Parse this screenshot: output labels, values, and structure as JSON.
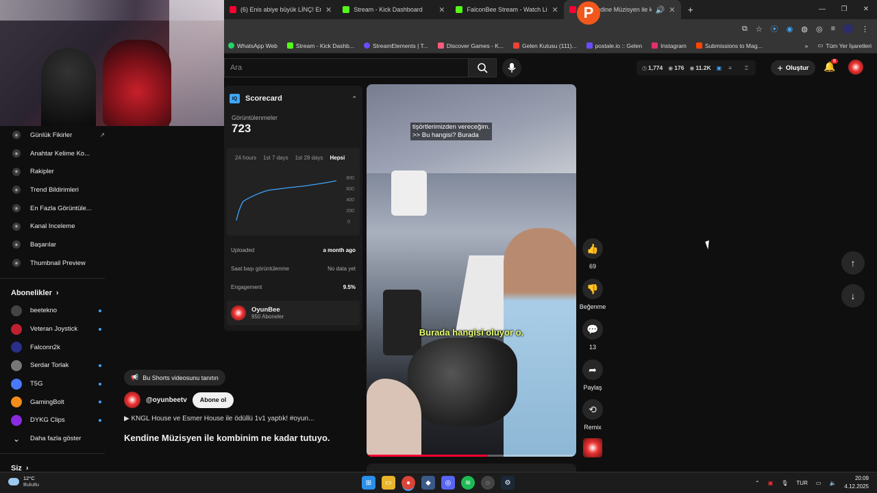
{
  "browser": {
    "tabs": [
      {
        "label": "(6) Enis abiye büyük LİNÇ! Eme",
        "color": "#ff0033",
        "active": false
      },
      {
        "label": "Stream - Kick Dashboard",
        "color": "#53fc18",
        "active": false
      },
      {
        "label": "FalconBee Stream - Watch Live",
        "color": "#53fc18",
        "active": false
      },
      {
        "label": "(8) Kendine Müzisyen ile ko",
        "color": "#ff0033",
        "active": true
      }
    ],
    "new_tab": "+",
    "bookmarks": [
      {
        "label": "WhatsApp Web",
        "color": "#25d366"
      },
      {
        "label": "Stream - Kick Dashb...",
        "color": "#53fc18"
      },
      {
        "label": "StreamElements | T...",
        "color": "#6b4cff"
      },
      {
        "label": "Discover Games - K...",
        "color": "#ff5a7a"
      },
      {
        "label": "Gelen Kutusu (111)...",
        "color": "#ea4335"
      },
      {
        "label": "postale.io :: Gelen",
        "color": "#6b4cff"
      },
      {
        "label": "Instagram",
        "color": "#e1306c"
      },
      {
        "label": "Submissions to Mag...",
        "color": "#ff4500"
      }
    ],
    "bookmarks_more": "»",
    "all_bookmarks": "Tüm Yer İşaretleri",
    "profile_letter": "P"
  },
  "youtube": {
    "search_placeholder": "Ara",
    "stats": {
      "watch": "1,774",
      "views": "176",
      "subs": "11.2K"
    },
    "create_label": "Oluştur",
    "notif_count": "8"
  },
  "sidebar": {
    "tools": [
      {
        "label": "Günlük Fikirler",
        "external": "↗"
      },
      {
        "label": "Anahtar Kelime Ko..."
      },
      {
        "label": "Rakipler"
      },
      {
        "label": "Trend Bildirimleri"
      },
      {
        "label": "En Fazla Görüntüle..."
      },
      {
        "label": "Kanal Inceleme"
      },
      {
        "label": "Başarılar"
      },
      {
        "label": "Thumbnail Preview"
      }
    ],
    "subs_heading": "Abonelikler",
    "subs": [
      {
        "name": "beetekno",
        "color": "#444",
        "live": true
      },
      {
        "name": "Veteran Joystick",
        "color": "#c02030",
        "live": true
      },
      {
        "name": "Falconn2k",
        "color": "#2a2f8a",
        "live": false
      },
      {
        "name": "Serdar Torlak",
        "color": "#777",
        "live": true
      },
      {
        "name": "T5G",
        "color": "#4a78ff",
        "live": true
      },
      {
        "name": "GamingBolt",
        "color": "#f28c1a",
        "live": true
      },
      {
        "name": "DYKG Clips",
        "color": "#8a2be2",
        "live": true
      }
    ],
    "show_more": "Daha fazla göster",
    "you_heading": "Siz"
  },
  "scorecard": {
    "title": "Scorecard",
    "logo": "IQ",
    "views_label": "Görüntülenmeler",
    "views_value": "723",
    "tabs": [
      "24 hours",
      "1st 7 days",
      "1st 28 days",
      "Hepsi"
    ],
    "active_tab": "Hepsi",
    "y_ticks": [
      "800",
      "600",
      "400",
      "200",
      "0"
    ],
    "uploaded_label": "Uploaded",
    "uploaded_value": "a month ago",
    "hourly_label": "Saat başı görüntülenme",
    "hourly_value": "No data yet",
    "engagement_label": "Engagement",
    "engagement_value": "9.5%",
    "channel_name": "OyunBee",
    "channel_subs": "950 Aboneler"
  },
  "video": {
    "caption_top_1": "tişörtlerimizden vereceğim.",
    "caption_top_2": ">> Bu hangisi? Burada",
    "caption_mid": "Burada hangisi oluyor o.",
    "progress": 0.58
  },
  "actions": {
    "likes": "69",
    "dislike_label": "Beğenme",
    "comments": "13",
    "share_label": "Paylaş",
    "remix_label": "Remix"
  },
  "short_info": {
    "promo_label": "Bu Shorts videosunu tanıtın",
    "channel_handle": "@oyunbeetv",
    "subscribe_label": "Abone ol",
    "music": "▶ KNGL House ve Esmer House ile ödüllü 1v1 yaptık! #oyun...",
    "title": "Kendine Müzisyen ile kombinim ne kadar tutuyo..."
  },
  "taskbar": {
    "temp": "12°C",
    "weather": "Bulutlu",
    "lang": "TUR",
    "time": "20:09",
    "date": "4.12.2025"
  }
}
